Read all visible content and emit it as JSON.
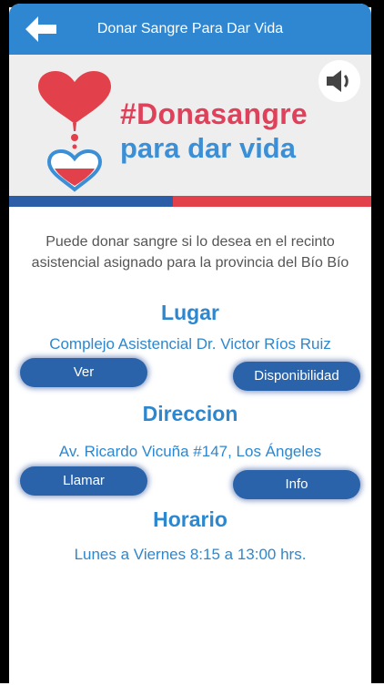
{
  "header": {
    "title": "Donar Sangre Para Dar Vida"
  },
  "icons": {
    "back": "arrow-left-icon",
    "audio": "speaker-icon"
  },
  "banner": {
    "hashtag": "#Donasangre",
    "subtitle": "para dar vida"
  },
  "intro": {
    "line1": "Puede donar sangre si lo desea en el recinto",
    "line2": "asistencial asignado para la provincia del Bío Bío"
  },
  "lugar": {
    "heading": "Lugar",
    "value": "Complejo Asistencial Dr. Victor Ríos Ruiz",
    "buttons": {
      "left": "Ver",
      "right": "Disponibilidad"
    }
  },
  "direccion": {
    "heading": "Direccion",
    "value": "Av. Ricardo Vicuña #147, Los Ángeles",
    "buttons": {
      "left": "Llamar",
      "right": "Info"
    }
  },
  "horario": {
    "heading": "Horario",
    "value": "Lunes a Viernes 8:15 a 13:00 hrs."
  },
  "colors": {
    "accent": "#2f86d1",
    "button": "#2b63aa",
    "red": "#e2414b",
    "navy": "#2b5ea7"
  }
}
